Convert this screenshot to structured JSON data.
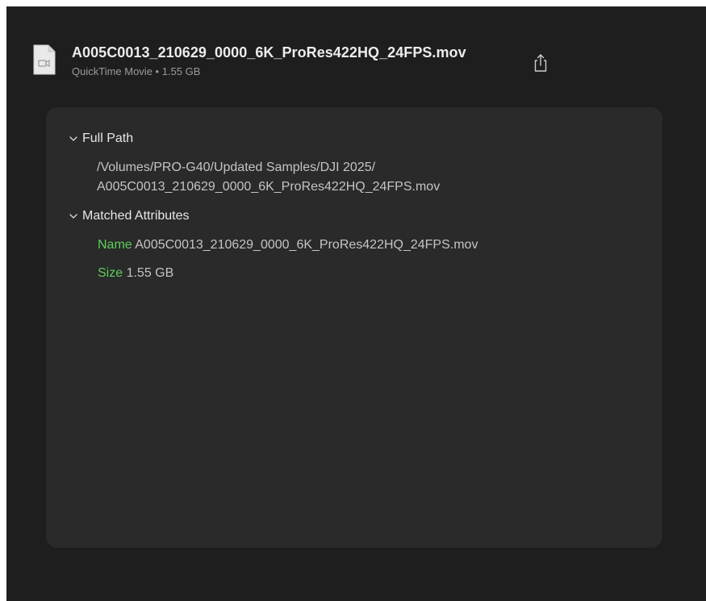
{
  "file": {
    "name": "A005C0013_210629_0000_6K_ProRes422HQ_24FPS.mov",
    "subtitle": "QuickTime Movie • 1.55 GB",
    "icon": "video-file-icon"
  },
  "share": {
    "icon": "share-icon"
  },
  "sections": {
    "full_path": {
      "title": "Full Path",
      "line1": "/Volumes/PRO-G40/Updated Samples/DJI 2025/",
      "line2": "A005C0013_210629_0000_6K_ProRes422HQ_24FPS.mov"
    },
    "matched_attributes": {
      "title": "Matched Attributes",
      "items": [
        {
          "key": "Name",
          "value": "A005C0013_210629_0000_6K_ProRes422HQ_24FPS.mov"
        },
        {
          "key": "Size",
          "value": "1.55 GB"
        }
      ]
    }
  },
  "colors": {
    "background": "#1e1e1e",
    "card": "#2a2a2a",
    "attribute_key": "#5ccf5c"
  }
}
